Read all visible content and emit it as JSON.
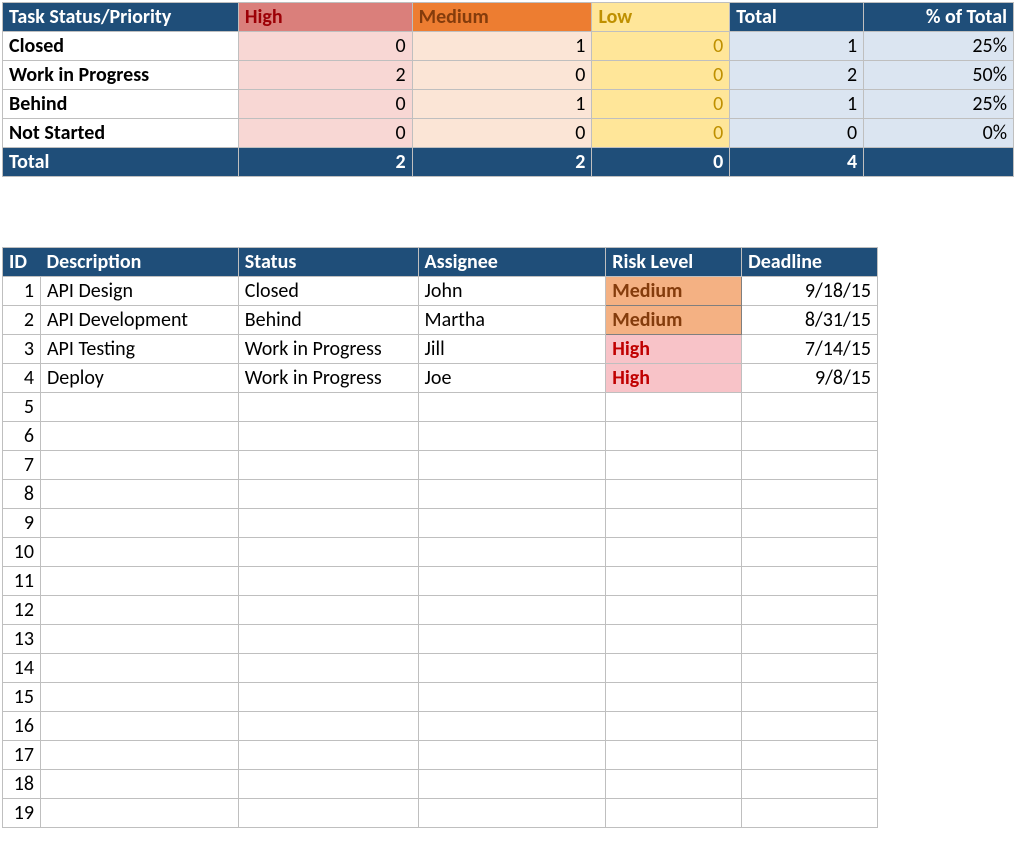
{
  "summary": {
    "headers": {
      "task": "Task Status/Priority",
      "high": "High",
      "med": "Medium",
      "low": "Low",
      "total": "Total",
      "pct": "% of Total"
    },
    "rows": [
      {
        "label": "Closed",
        "high": "0",
        "med": "1",
        "low": "0",
        "total": "1",
        "pct": "25%"
      },
      {
        "label": "Work in Progress",
        "high": "2",
        "med": "0",
        "low": "0",
        "total": "2",
        "pct": "50%"
      },
      {
        "label": "Behind",
        "high": "0",
        "med": "1",
        "low": "0",
        "total": "1",
        "pct": "25%"
      },
      {
        "label": "Not Started",
        "high": "0",
        "med": "0",
        "low": "0",
        "total": "0",
        "pct": "0%"
      }
    ],
    "totals": {
      "label": "Total",
      "high": "2",
      "med": "2",
      "low": "0",
      "total": "4",
      "pct": ""
    }
  },
  "detail": {
    "headers": {
      "id": "ID",
      "desc": "Description",
      "status": "Status",
      "assignee": "Assignee",
      "risk": "Risk Level",
      "deadline": "Deadline"
    },
    "rows": [
      {
        "id": "1",
        "desc": "API Design",
        "status": "Closed",
        "assignee": "John",
        "risk": "Medium",
        "risk_class": "risk-med",
        "deadline": "9/18/15"
      },
      {
        "id": "2",
        "desc": "API Development",
        "status": "Behind",
        "assignee": "Martha",
        "risk": "Medium",
        "risk_class": "risk-med",
        "deadline": "8/31/15"
      },
      {
        "id": "3",
        "desc": "API Testing",
        "status": "Work in Progress",
        "assignee": "Jill",
        "risk": "High",
        "risk_class": "risk-high",
        "deadline": "7/14/15"
      },
      {
        "id": "4",
        "desc": "Deploy",
        "status": "Work in Progress",
        "assignee": "Joe",
        "risk": "High",
        "risk_class": "risk-high",
        "deadline": "9/8/15"
      }
    ],
    "empty_start": 5,
    "empty_end": 19
  }
}
